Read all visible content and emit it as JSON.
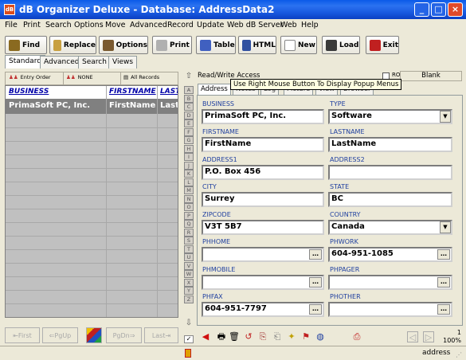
{
  "window": {
    "title": "dB Organizer Deluxe - Database: AddressData2",
    "app_icon": "dB"
  },
  "menu": [
    "File",
    "Print",
    "Search",
    "Options",
    "Move",
    "Advanced",
    "Record",
    "Update",
    "Web dB Server",
    "Web",
    "Help"
  ],
  "toolbar": [
    "Find",
    "Replace",
    "Options",
    "Print",
    "Table",
    "HTML",
    "New",
    "Load",
    "Exit"
  ],
  "main_tabs": [
    "Standard",
    "Advanced",
    "Search",
    "Views"
  ],
  "list_toolbar": {
    "entry_order": "Entry Order",
    "none": "NONE",
    "all_records": "All Records"
  },
  "grid": {
    "columns": [
      "BUSINESS",
      "FIRSTNAME",
      "LAST"
    ],
    "rows": [
      [
        "PrimaSoft PC, Inc.",
        "FirstName",
        "Last"
      ]
    ]
  },
  "nav": {
    "first": "First",
    "pgup": "PgUp",
    "pgdn": "PgDn",
    "last": "Last"
  },
  "alpha_index": [
    "A",
    "B",
    "C",
    "D",
    "E",
    "F",
    "G",
    "H",
    "I",
    "J",
    "K",
    "L",
    "M",
    "N",
    "O",
    "P",
    "Q",
    "R",
    "S",
    "T",
    "U",
    "V",
    "W",
    "X",
    "Y",
    "Z"
  ],
  "access_mode": "Read/Write Access",
  "ro_label": "RO",
  "blank_label": "Blank",
  "tooltip": "Use Right Mouse Button To Display Popup Menus",
  "record_tabs": [
    "Address",
    "Notes",
    "Log",
    "Picture",
    "View",
    "Browser"
  ],
  "fields": {
    "business": {
      "label": "BUSINESS",
      "value": "PrimaSoft PC, Inc."
    },
    "type": {
      "label": "TYPE",
      "value": "Software"
    },
    "firstname": {
      "label": "FIRSTNAME",
      "value": "FirstName"
    },
    "lastname": {
      "label": "LASTNAME",
      "value": "LastName"
    },
    "address1": {
      "label": "ADDRESS1",
      "value": "P.O. Box 456"
    },
    "address2": {
      "label": "ADDRESS2",
      "value": ""
    },
    "city": {
      "label": "CITY",
      "value": "Surrey"
    },
    "state": {
      "label": "STATE",
      "value": "BC"
    },
    "zipcode": {
      "label": "ZIPCODE",
      "value": "V3T 5B7"
    },
    "country": {
      "label": "COUNTRY",
      "value": "Canada"
    },
    "phhome": {
      "label": "PHHOME",
      "value": ""
    },
    "phwork": {
      "label": "PHWORK",
      "value": "604-951-1085"
    },
    "phmobile": {
      "label": "PHMOBILE",
      "value": ""
    },
    "phpager": {
      "label": "PHPAGER",
      "value": ""
    },
    "phfax": {
      "label": "PHFAX",
      "value": "604-951-7797"
    },
    "phother": {
      "label": "PHOTHER",
      "value": ""
    }
  },
  "record_number": "1",
  "zoom": "100%",
  "status_table": "address"
}
